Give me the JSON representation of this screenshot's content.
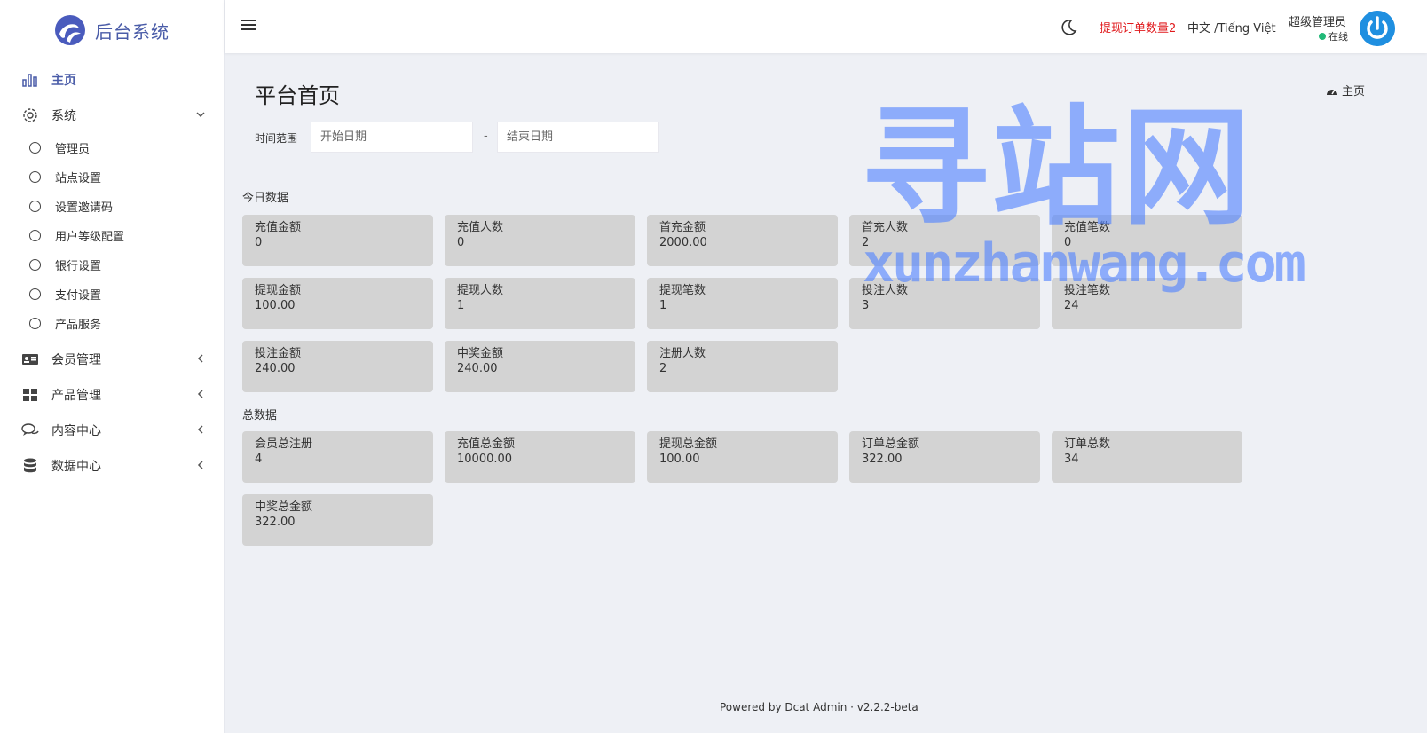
{
  "brand": {
    "title": "后台系统"
  },
  "sidebar": {
    "items": [
      {
        "label": "主页",
        "icon": "bar-chart-icon",
        "active": true
      },
      {
        "label": "系统",
        "icon": "gear-icon",
        "expanded": true,
        "children": [
          "管理员",
          "站点设置",
          "设置邀请码",
          "用户等级配置",
          "银行设置",
          "支付设置",
          "产品服务"
        ]
      },
      {
        "label": "会员管理",
        "icon": "id-card-icon"
      },
      {
        "label": "产品管理",
        "icon": "grid-icon"
      },
      {
        "label": "内容中心",
        "icon": "chat-icon"
      },
      {
        "label": "数据中心",
        "icon": "database-icon"
      }
    ]
  },
  "header": {
    "withdraw_alert": "提现订单数量2",
    "language": "中文 /Tiếng Việt",
    "user_name": "超级管理员",
    "user_status": "在线",
    "status_color": "#21b978"
  },
  "page": {
    "title": "平台首页",
    "breadcrumb": "主页",
    "filter_label": "时间范围",
    "start_placeholder": "开始日期",
    "end_placeholder": "结束日期",
    "date_separator": "-"
  },
  "today": {
    "title": "今日数据",
    "cards": [
      {
        "label": "充值金额",
        "value": "0"
      },
      {
        "label": "充值人数",
        "value": "0"
      },
      {
        "label": "首充金额",
        "value": "2000.00"
      },
      {
        "label": "首充人数",
        "value": "2"
      },
      {
        "label": "充值笔数",
        "value": "0"
      },
      {
        "label": "提现金额",
        "value": "100.00"
      },
      {
        "label": "提现人数",
        "value": "1"
      },
      {
        "label": "提现笔数",
        "value": "1"
      },
      {
        "label": "投注人数",
        "value": "3"
      },
      {
        "label": "投注笔数",
        "value": "24"
      },
      {
        "label": "投注金额",
        "value": "240.00"
      },
      {
        "label": "中奖金额",
        "value": "240.00"
      },
      {
        "label": "注册人数",
        "value": "2"
      }
    ]
  },
  "total": {
    "title": "总数据",
    "cards": [
      {
        "label": "会员总注册",
        "value": "4"
      },
      {
        "label": "充值总金额",
        "value": "10000.00"
      },
      {
        "label": "提现总金额",
        "value": "100.00"
      },
      {
        "label": "订单总金额",
        "value": "322.00"
      },
      {
        "label": "订单总数",
        "value": "34"
      },
      {
        "label": "中奖总金额",
        "value": "322.00"
      }
    ]
  },
  "watermark": {
    "main": "寻站网",
    "sub": "xunzhanwang.com"
  },
  "footer": {
    "text": "Powered by Dcat Admin · v2.2.2-beta"
  }
}
